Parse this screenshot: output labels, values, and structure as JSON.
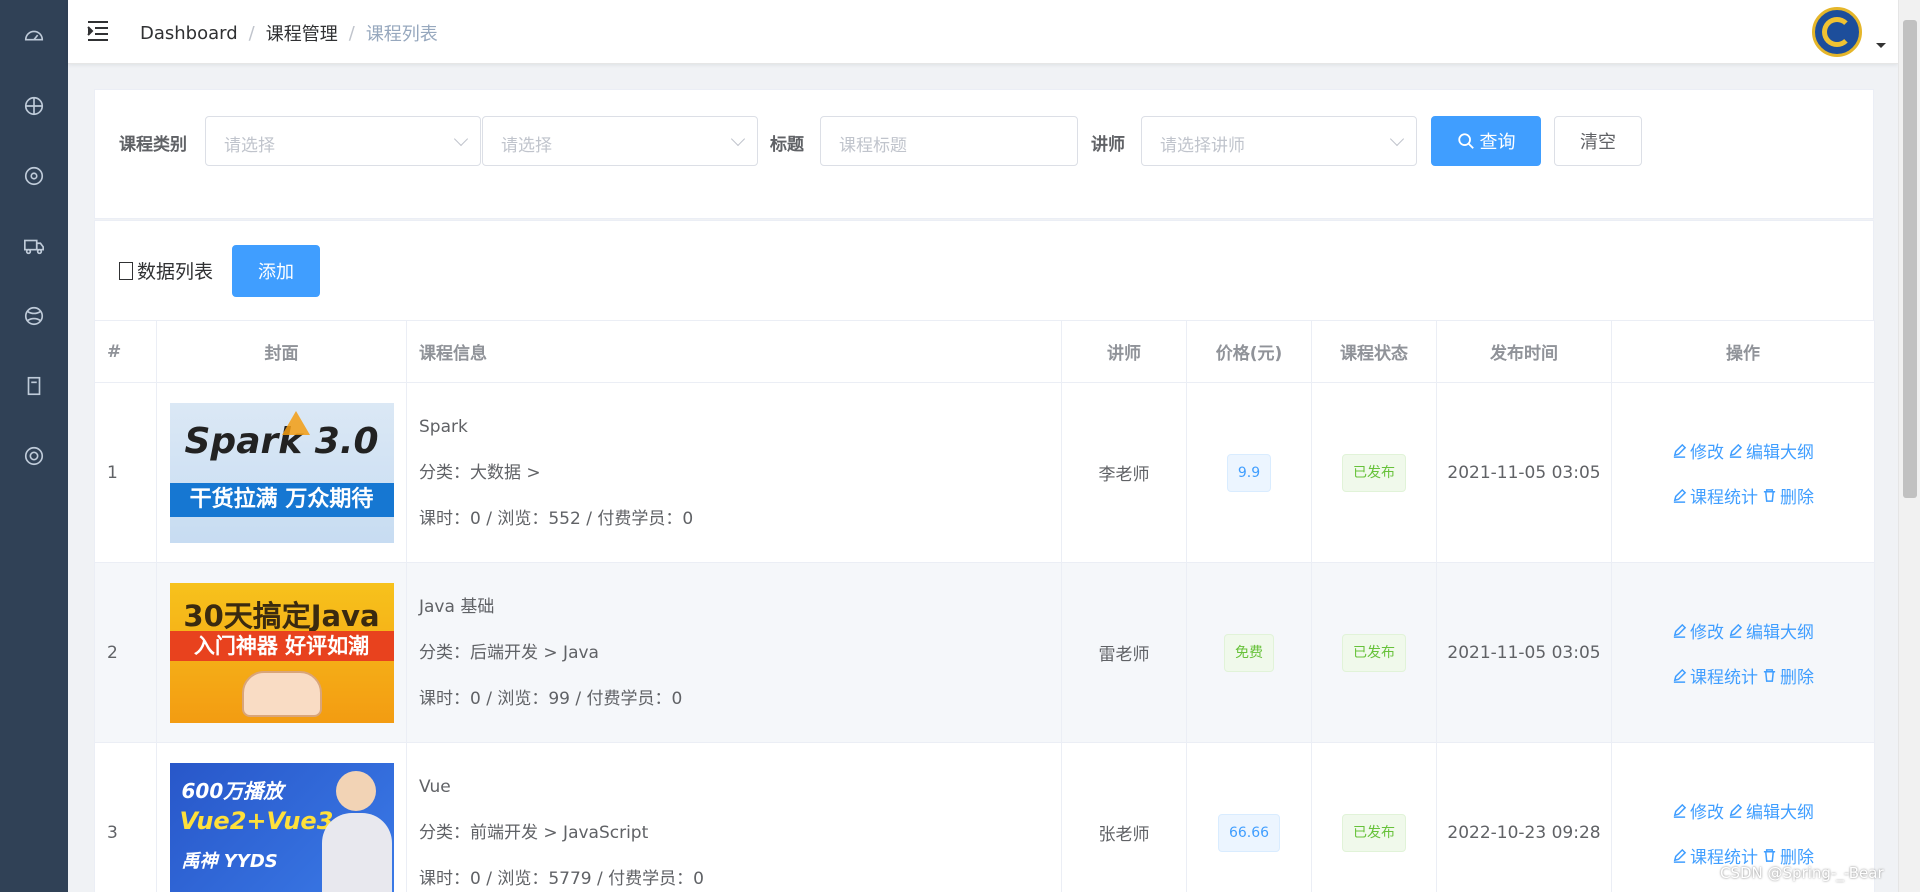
{
  "sidebar": {
    "items": [
      "dashboard-icon",
      "circle-icon",
      "circle-dot-icon",
      "truck-icon",
      "ball-icon",
      "book-icon",
      "lifebuoy-icon"
    ]
  },
  "header": {
    "breadcrumb": [
      "Dashboard",
      "课程管理",
      "课程列表"
    ]
  },
  "filter": {
    "category_label": "课程类别",
    "category1_placeholder": "请选择",
    "category2_placeholder": "请选择",
    "title_label": "标题",
    "title_placeholder": "课程标题",
    "teacher_label": "讲师",
    "teacher_placeholder": "请选择讲师",
    "search_label": "查询",
    "clear_label": "清空"
  },
  "list": {
    "title": "数据列表",
    "add_label": "添加"
  },
  "table": {
    "columns": [
      "#",
      "封面",
      "课程信息",
      "讲师",
      "价格(元)",
      "课程状态",
      "发布时间",
      "操作"
    ],
    "rows": [
      {
        "index": "1",
        "cover": {
          "line1": "Spark 3.0",
          "line2": "干货拉满  万众期待"
        },
        "name": "Spark",
        "category": "分类：大数据 >",
        "stats": "课时：0 / 浏览：552 / 付费学员：0",
        "teacher": "李老师",
        "price": "9.9",
        "price_style": "blue",
        "status": "已发布",
        "time": "2021-11-05 03:05"
      },
      {
        "index": "2",
        "cover": {
          "line1": "30天搞定Java",
          "line2": "入门神器  好评如潮"
        },
        "name": "Java 基础",
        "category": "分类：后端开发 > Java",
        "stats": "课时：0 / 浏览：99 / 付费学员：0",
        "teacher": "雷老师",
        "price": "免费",
        "price_style": "green",
        "status": "已发布",
        "time": "2021-11-05 03:05"
      },
      {
        "index": "3",
        "cover": {
          "line1": "600万播放",
          "line2": "Vue2+Vue3",
          "line3": "禹神 YYDS"
        },
        "name": "Vue",
        "category": "分类：前端开发 > JavaScript",
        "stats": "课时：0 / 浏览：5779 / 付费学员：0",
        "teacher": "张老师",
        "price": "66.66",
        "price_style": "blue",
        "status": "已发布",
        "time": "2022-10-23 09:28"
      }
    ],
    "ops": {
      "edit": "修改",
      "outline": "编辑大纲",
      "stats": "课程统计",
      "delete": "删除"
    }
  },
  "watermark": "CSDN @Spring-_-Bear"
}
